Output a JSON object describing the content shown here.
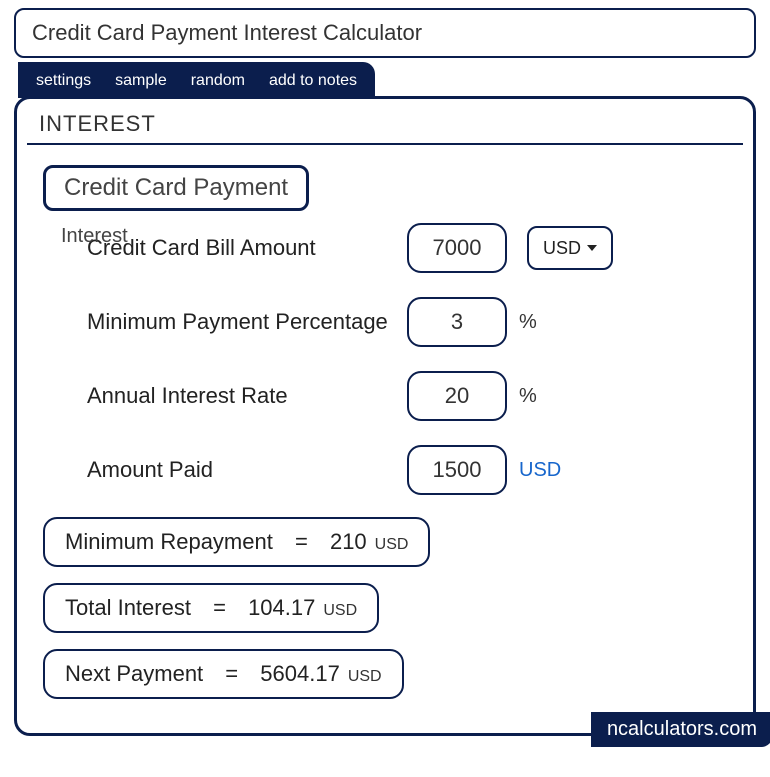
{
  "title": "Credit Card Payment Interest Calculator",
  "tabs": [
    "settings",
    "sample",
    "random",
    "add to notes"
  ],
  "section": "INTEREST",
  "category": "Credit Card Payment",
  "ghost": "Interest",
  "currency_selector": "USD",
  "inputs": {
    "bill": {
      "label": "Credit Card Bill Amount",
      "value": "7000"
    },
    "minpct": {
      "label": "Minimum Payment Percentage",
      "value": "3",
      "unit": "%"
    },
    "rate": {
      "label": "Annual Interest Rate",
      "value": "20",
      "unit": "%"
    },
    "paid": {
      "label": "Amount Paid",
      "value": "1500",
      "unit": "USD"
    }
  },
  "results": {
    "minrepay": {
      "label": "Minimum Repayment",
      "value": "210",
      "unit": "USD"
    },
    "totint": {
      "label": "Total Interest",
      "value": "104.17",
      "unit": "USD"
    },
    "nextpay": {
      "label": "Next Payment",
      "value": "5604.17",
      "unit": "USD"
    }
  },
  "watermark": "ncalculators.com",
  "eq": "="
}
